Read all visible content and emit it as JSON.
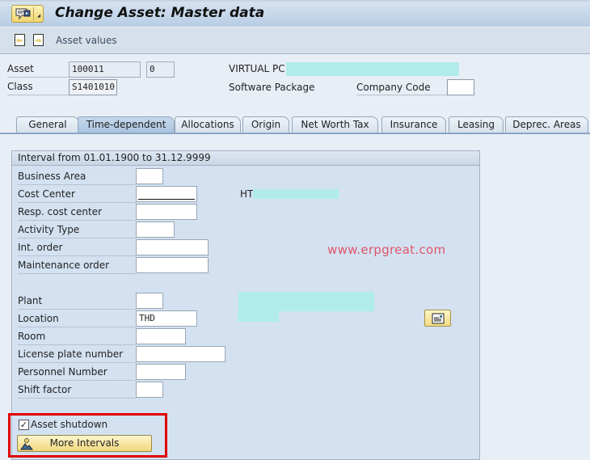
{
  "window": {
    "title": "Change Asset:  Master data",
    "menu_icon": "tooltip-menu-icon"
  },
  "toolbar": {
    "prev_icon": "previous-document-icon",
    "next_icon": "next-document-icon",
    "asset_values_label": "Asset values"
  },
  "header": {
    "asset_label": "Asset",
    "asset_number": "100011",
    "asset_subnumber": "0",
    "asset_description_label": "VIRTUAL PC",
    "class_label": "Class",
    "class_value": "S1401010",
    "class_description": "Software Package",
    "company_code_label": "Company Code",
    "company_code_value": ""
  },
  "tabs": [
    {
      "label": "General",
      "active": false
    },
    {
      "label": "Time-dependent",
      "active": true
    },
    {
      "label": "Allocations",
      "active": false
    },
    {
      "label": "Origin",
      "active": false
    },
    {
      "label": "Net Worth Tax",
      "active": false
    },
    {
      "label": "Insurance",
      "active": false
    },
    {
      "label": "Leasing",
      "active": false
    },
    {
      "label": "Deprec. Areas",
      "active": false
    }
  ],
  "panel": {
    "interval_title": "Interval from 01.01.1900 to 31.12.9999",
    "fields": [
      {
        "label": "Business Area",
        "value": ""
      },
      {
        "label": "Cost Center",
        "value": "",
        "description": "HT"
      },
      {
        "label": "Resp. cost center",
        "value": ""
      },
      {
        "label": "Activity Type",
        "value": ""
      },
      {
        "label": "Int. order",
        "value": ""
      },
      {
        "label": "Maintenance order",
        "value": ""
      },
      {
        "label": "Plant",
        "value": ""
      },
      {
        "label": "Location",
        "value": "THD"
      },
      {
        "label": "Room",
        "value": ""
      },
      {
        "label": "License plate number",
        "value": ""
      },
      {
        "label": "Personnel Number",
        "value": ""
      },
      {
        "label": "Shift factor",
        "value": ""
      }
    ],
    "watermark": "www.erpgreat.com",
    "note_icon": "long-text-icon",
    "asset_shutdown_label": "Asset shutdown",
    "asset_shutdown_checked": true,
    "checkmark": "✓",
    "more_intervals_label": "More Intervals"
  },
  "colors": {
    "highlight_box": "#e00000",
    "redaction": "#b1ecec",
    "watermark": "#e0576a"
  }
}
